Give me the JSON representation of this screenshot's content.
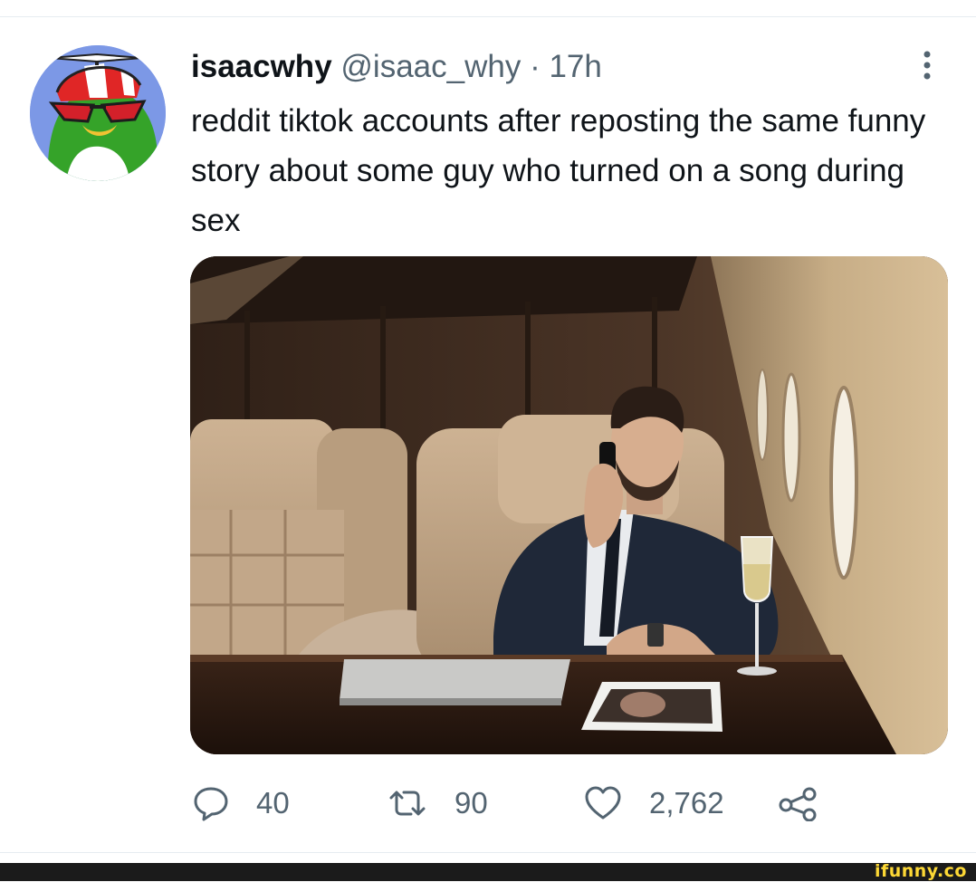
{
  "tweet": {
    "display_name": "isaacwhy",
    "handle": "@isaac_why",
    "separator": "·",
    "time": "17h",
    "text": "reddit tiktok accounts after reposting the same funny story about some guy who turned on a song during sex"
  },
  "icons": {
    "avatar": "green-bird-propeller-cap-avatar",
    "more": "more-vertical-icon",
    "reply": "reply-bubble-icon",
    "retweet": "retweet-icon",
    "like": "heart-icon",
    "share": "share-icon"
  },
  "media": {
    "description_icon": "photo"
  },
  "actions": {
    "replies": "40",
    "retweets": "90",
    "likes": "2,762"
  },
  "watermark": "ifunny.co",
  "colors": {
    "text": "#0f1419",
    "secondary": "#536471",
    "divider": "#e6ecf0",
    "watermark": "#fdd835"
  }
}
